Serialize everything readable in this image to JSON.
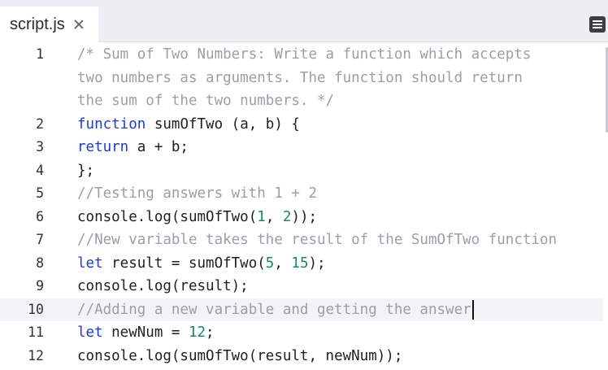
{
  "tab": {
    "filename": "script.js",
    "close_symbol": "×"
  },
  "toolbar": {
    "menu_icon": "hamburger-menu-icon"
  },
  "colors": {
    "comment": "#9aa0a6",
    "keyword": "#1c3bd6",
    "number": "#15876b",
    "text": "#1e1e1e",
    "active_line": "#f2f3f5",
    "tabbar_bg": "#eceef1"
  },
  "editor": {
    "active_line": "10",
    "lines": [
      {
        "n": "1",
        "tokens": [
          [
            "comment",
            "/* Sum of Two Numbers: Write a function which accepts"
          ]
        ]
      },
      {
        "n": "",
        "tokens": [
          [
            "comment",
            "two numbers as arguments. The function should return"
          ]
        ]
      },
      {
        "n": "",
        "tokens": [
          [
            "comment",
            "the sum of the two numbers. */"
          ]
        ]
      },
      {
        "n": "2",
        "tokens": [
          [
            "keyword",
            "function"
          ],
          [
            "plain",
            " sumOfTwo (a, b) {"
          ]
        ]
      },
      {
        "n": "3",
        "tokens": [
          [
            "keyword",
            "return"
          ],
          [
            "plain",
            " a + b;"
          ]
        ]
      },
      {
        "n": "4",
        "tokens": [
          [
            "plain",
            "};"
          ]
        ]
      },
      {
        "n": "5",
        "tokens": [
          [
            "comment",
            "//Testing answers with 1 + 2"
          ]
        ]
      },
      {
        "n": "6",
        "tokens": [
          [
            "plain",
            "console.log(sumOfTwo("
          ],
          [
            "number",
            "1"
          ],
          [
            "plain",
            ", "
          ],
          [
            "number",
            "2"
          ],
          [
            "plain",
            "));"
          ]
        ]
      },
      {
        "n": "7",
        "tokens": [
          [
            "comment",
            "//New variable takes the result of the SumOfTwo function"
          ]
        ]
      },
      {
        "n": "8",
        "tokens": [
          [
            "keyword",
            "let"
          ],
          [
            "plain",
            " result = sumOfTwo("
          ],
          [
            "number",
            "5"
          ],
          [
            "plain",
            ", "
          ],
          [
            "number",
            "15"
          ],
          [
            "plain",
            ");"
          ]
        ]
      },
      {
        "n": "9",
        "tokens": [
          [
            "plain",
            "console.log(result);"
          ]
        ]
      },
      {
        "n": "10",
        "tokens": [
          [
            "comment",
            "//Adding a new variable and getting the answer"
          ]
        ],
        "cursor": true
      },
      {
        "n": "11",
        "tokens": [
          [
            "keyword",
            "let"
          ],
          [
            "plain",
            " newNum = "
          ],
          [
            "number",
            "12"
          ],
          [
            "plain",
            ";"
          ]
        ]
      },
      {
        "n": "12",
        "tokens": [
          [
            "plain",
            "console.log(sumOfTwo(result, newNum));"
          ]
        ]
      }
    ]
  }
}
